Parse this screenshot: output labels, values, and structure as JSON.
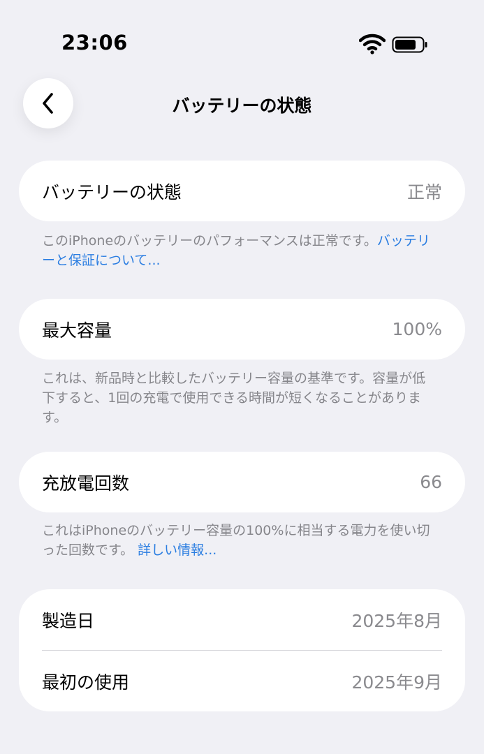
{
  "status_bar": {
    "time": "23:06",
    "icons": [
      "wifi-icon",
      "battery-icon"
    ]
  },
  "header": {
    "back_icon": "chevron-left-icon",
    "title": "バッテリーの状態"
  },
  "colors": {
    "background": "#f0f0f5",
    "card": "#ffffff",
    "link": "#2a7de1",
    "secondary_text": "#8a8a8e"
  },
  "sections": {
    "health": {
      "label": "バッテリーの状態",
      "value": "正常",
      "note": "このiPhoneのバッテリーのパフォーマンスは正常です。",
      "note_link": "バッテリーと保証について..."
    },
    "capacity": {
      "label": "最大容量",
      "value": "100%",
      "note": "これは、新品時と比較したバッテリー容量の基準です。容量が低下すると、1回の充電で使用できる時間が短くなることがあります。"
    },
    "cycles": {
      "label": "充放電回数",
      "value": "66",
      "note": "これはiPhoneのバッテリー容量の100%に相当する電力を使い切った回数です。",
      "note_link": "詳しい情報..."
    },
    "dates": {
      "manufactured_label": "製造日",
      "manufactured_value": "2025年8月",
      "first_use_label": "最初の使用",
      "first_use_value": "2025年9月"
    }
  }
}
